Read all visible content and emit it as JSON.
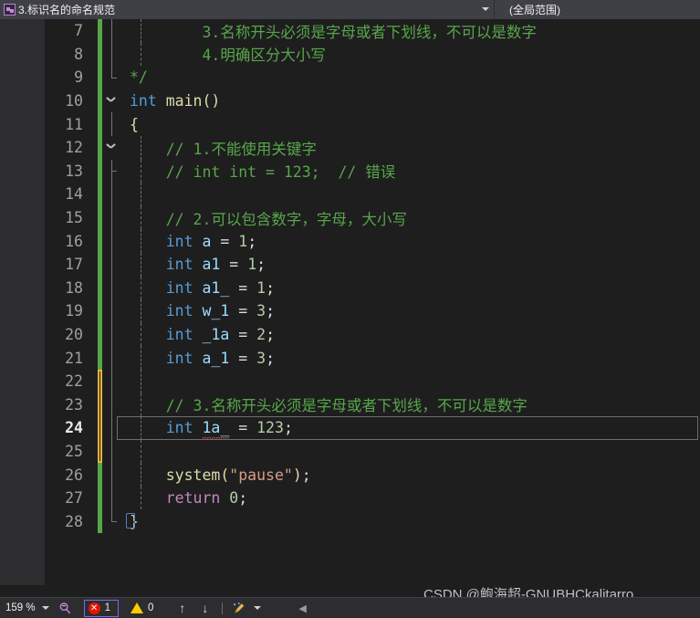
{
  "navbar": {
    "file_icon": "cpp-file-icon",
    "file_scope": "3.标识名的命名规范",
    "member_scope": "(全局范围)",
    "caret_icon": "chevron-down-icon"
  },
  "editor": {
    "first_visible_line": 7,
    "current_line": 24,
    "lines": [
      {
        "no": "7",
        "changebar": "green",
        "fold": "bracket-mid",
        "indent_guide": true,
        "tokens": [
          {
            "t": "cmt",
            "s": "        3.名称开头必须是字母或者下划线，不可以是数字"
          }
        ]
      },
      {
        "no": "8",
        "changebar": "green",
        "fold": "bracket-mid",
        "indent_guide": true,
        "tokens": [
          {
            "t": "cmt",
            "s": "        4.明确区分大小写"
          }
        ]
      },
      {
        "no": "9",
        "changebar": "green",
        "fold": "bracket-end",
        "indent_guide": false,
        "tokens": [
          {
            "t": "cmt",
            "s": "*/"
          }
        ]
      },
      {
        "no": "10",
        "changebar": "green",
        "fold": "chevron",
        "indent_guide": false,
        "tokens": [
          {
            "t": "kw",
            "s": "int"
          },
          {
            "t": "punct",
            "s": " "
          },
          {
            "t": "fn",
            "s": "main"
          },
          {
            "t": "brace",
            "s": "()"
          }
        ]
      },
      {
        "no": "11",
        "changebar": "green",
        "fold": "line",
        "indent_guide": false,
        "tokens": [
          {
            "t": "brace",
            "s": "{"
          }
        ]
      },
      {
        "no": "12",
        "changebar": "green",
        "fold": "chevron",
        "indent_guide": true,
        "tokens": [
          {
            "t": "cmt",
            "s": "    // 1.不能使用关键字"
          }
        ]
      },
      {
        "no": "13",
        "changebar": "green",
        "fold": "bracket-end2",
        "indent_guide": true,
        "tokens": [
          {
            "t": "cmt",
            "s": "    // int int = 123;  // 错误"
          }
        ]
      },
      {
        "no": "14",
        "changebar": "green",
        "fold": "line",
        "indent_guide": true,
        "tokens": []
      },
      {
        "no": "15",
        "changebar": "green",
        "fold": "line",
        "indent_guide": true,
        "tokens": [
          {
            "t": "cmt",
            "s": "    // 2.可以包含数字，字母，大小写"
          }
        ]
      },
      {
        "no": "16",
        "changebar": "green",
        "fold": "line",
        "indent_guide": true,
        "tokens": [
          {
            "t": "punct",
            "s": "    "
          },
          {
            "t": "kw",
            "s": "int"
          },
          {
            "t": "punct",
            "s": " "
          },
          {
            "t": "ident",
            "s": "a"
          },
          {
            "t": "punct",
            "s": " = "
          },
          {
            "t": "num",
            "s": "1"
          },
          {
            "t": "punct",
            "s": ";"
          }
        ]
      },
      {
        "no": "17",
        "changebar": "green",
        "fold": "line",
        "indent_guide": true,
        "tokens": [
          {
            "t": "punct",
            "s": "    "
          },
          {
            "t": "kw",
            "s": "int"
          },
          {
            "t": "punct",
            "s": " "
          },
          {
            "t": "ident",
            "s": "a1"
          },
          {
            "t": "punct",
            "s": " = "
          },
          {
            "t": "num",
            "s": "1"
          },
          {
            "t": "punct",
            "s": ";"
          }
        ]
      },
      {
        "no": "18",
        "changebar": "green",
        "fold": "line",
        "indent_guide": true,
        "tokens": [
          {
            "t": "punct",
            "s": "    "
          },
          {
            "t": "kw",
            "s": "int"
          },
          {
            "t": "punct",
            "s": " "
          },
          {
            "t": "ident",
            "s": "a1_"
          },
          {
            "t": "punct",
            "s": " = "
          },
          {
            "t": "num",
            "s": "1"
          },
          {
            "t": "punct",
            "s": ";"
          }
        ]
      },
      {
        "no": "19",
        "changebar": "green",
        "fold": "line",
        "indent_guide": true,
        "tokens": [
          {
            "t": "punct",
            "s": "    "
          },
          {
            "t": "kw",
            "s": "int"
          },
          {
            "t": "punct",
            "s": " "
          },
          {
            "t": "ident",
            "s": "w_1"
          },
          {
            "t": "punct",
            "s": " = "
          },
          {
            "t": "num",
            "s": "3"
          },
          {
            "t": "punct",
            "s": ";"
          }
        ]
      },
      {
        "no": "20",
        "changebar": "green",
        "fold": "line",
        "indent_guide": true,
        "tokens": [
          {
            "t": "punct",
            "s": "    "
          },
          {
            "t": "kw",
            "s": "int"
          },
          {
            "t": "punct",
            "s": " "
          },
          {
            "t": "ident",
            "s": "_1a"
          },
          {
            "t": "punct",
            "s": " = "
          },
          {
            "t": "num",
            "s": "2"
          },
          {
            "t": "punct",
            "s": ";"
          }
        ]
      },
      {
        "no": "21",
        "changebar": "green",
        "fold": "line",
        "indent_guide": true,
        "tokens": [
          {
            "t": "punct",
            "s": "    "
          },
          {
            "t": "kw",
            "s": "int"
          },
          {
            "t": "punct",
            "s": " "
          },
          {
            "t": "ident",
            "s": "a_1"
          },
          {
            "t": "punct",
            "s": " = "
          },
          {
            "t": "num",
            "s": "3"
          },
          {
            "t": "punct",
            "s": ";"
          }
        ]
      },
      {
        "no": "22",
        "changebar": "yellow-top",
        "fold": "line",
        "indent_guide": true,
        "tokens": []
      },
      {
        "no": "23",
        "changebar": "yellow",
        "fold": "line",
        "indent_guide": true,
        "tokens": [
          {
            "t": "cmt",
            "s": "    // 3.名称开头必须是字母或者下划线，不可以是数字"
          }
        ]
      },
      {
        "no": "24",
        "changebar": "yellow",
        "fold": "line",
        "indent_guide": true,
        "current": true,
        "tokens": [
          {
            "t": "punct",
            "s": "    "
          },
          {
            "t": "kw",
            "s": "int"
          },
          {
            "t": "punct",
            "s": " "
          },
          {
            "t": "ident squiggle",
            "s": "1a_"
          },
          {
            "t": "punct",
            "s": " = "
          },
          {
            "t": "num",
            "s": "123"
          },
          {
            "t": "punct",
            "s": ";"
          }
        ]
      },
      {
        "no": "25",
        "changebar": "yellow-bot",
        "fold": "line",
        "indent_guide": true,
        "tokens": []
      },
      {
        "no": "26",
        "changebar": "green",
        "fold": "line",
        "indent_guide": true,
        "tokens": [
          {
            "t": "punct",
            "s": "    "
          },
          {
            "t": "fn",
            "s": "system"
          },
          {
            "t": "brace",
            "s": "("
          },
          {
            "t": "str",
            "s": "\"pause\""
          },
          {
            "t": "brace",
            "s": ")"
          },
          {
            "t": "punct",
            "s": ";"
          }
        ]
      },
      {
        "no": "27",
        "changebar": "green",
        "fold": "line",
        "indent_guide": true,
        "tokens": [
          {
            "t": "punct",
            "s": "    "
          },
          {
            "t": "kw2",
            "s": "return"
          },
          {
            "t": "punct",
            "s": " "
          },
          {
            "t": "num",
            "s": "0"
          },
          {
            "t": "punct",
            "s": ";"
          }
        ]
      },
      {
        "no": "28",
        "changebar": "green",
        "fold": "bracket-close",
        "indent_guide": false,
        "brace_match": true,
        "tokens": [
          {
            "t": "brace",
            "s": "}"
          }
        ]
      }
    ]
  },
  "watermark": {
    "text": "CSDN @鲍海超-GNUBHCkalitarro"
  },
  "statusbar": {
    "zoom": "159 %",
    "zoom_caret_icon": "chevron-down-icon",
    "magnifier_icon": "code-lens-icon",
    "error_icon": "error-circle-icon",
    "error_count": "1",
    "warning_icon": "warning-triangle-icon",
    "warning_count": "0",
    "prev_icon": "arrow-up-icon",
    "next_icon": "arrow-down-icon",
    "broom_icon": "code-cleanup-broom-icon",
    "broom_caret_icon": "chevron-down-icon",
    "collapse_icon": "arrow-left-icon"
  },
  "colors": {
    "background": "#1e1e1e",
    "chrome": "#2d2d30",
    "navbar": "#3f3f46",
    "comment": "#57a64a",
    "keyword": "#569cd6",
    "string": "#d69d85",
    "number": "#b5cea8",
    "identifier": "#9cdcfe",
    "function": "#dcdcaa",
    "control_keyword": "#c586c0",
    "changebar_saved": "#57a64a",
    "changebar_unsaved": "#e8b23a",
    "error": "#e51400",
    "warning": "#ffcc00",
    "focus_border": "#7b68ee"
  }
}
